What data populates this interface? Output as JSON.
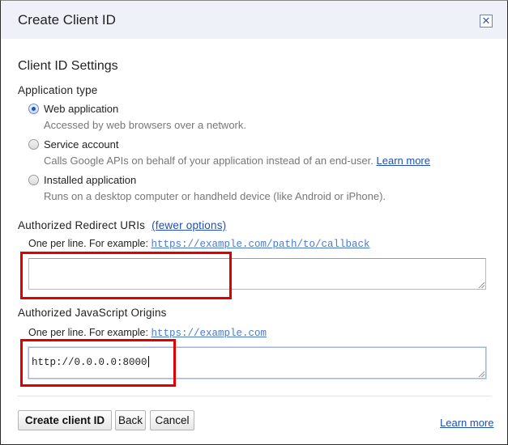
{
  "dialog": {
    "title": "Create Client ID",
    "close_glyph": "✕"
  },
  "settings": {
    "section_title": "Client ID Settings",
    "application_type_label": "Application type",
    "options": [
      {
        "label": "Web application",
        "description": "Accessed by web browsers over a network.",
        "checked": true
      },
      {
        "label": "Service account",
        "description": "Calls Google APIs on behalf of your application instead of an end-user.",
        "link": "Learn more",
        "checked": false
      },
      {
        "label": "Installed application",
        "description": "Runs on a desktop computer or handheld device (like Android or iPhone).",
        "checked": false
      }
    ]
  },
  "redirect": {
    "label": "Authorized Redirect URIs",
    "toggle_link": "(fewer options)",
    "hint": "One per line. For example:",
    "example": "https://example.com/path/to/callback",
    "value": ""
  },
  "origins": {
    "label": "Authorized JavaScript Origins",
    "hint": "One per line. For example:",
    "example": "https://example.com",
    "value": "http://0.0.0.0:8000"
  },
  "buttons": {
    "create": "Create client ID",
    "back": "Back",
    "cancel": "Cancel"
  },
  "footer": {
    "learn_more": "Learn more"
  },
  "colors": {
    "accent": "#1f4fb8",
    "highlight": "#e00000"
  }
}
